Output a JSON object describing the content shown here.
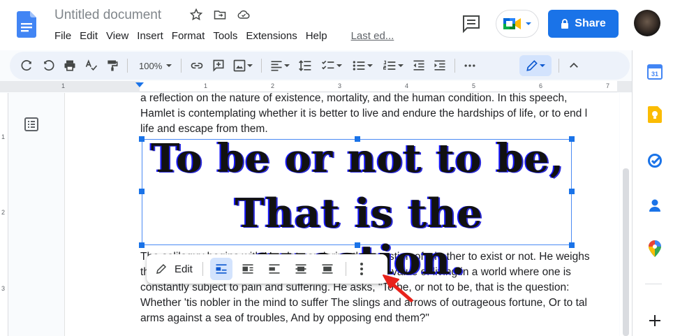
{
  "app": {
    "title": "Untitled document",
    "menu": [
      "File",
      "Edit",
      "View",
      "Insert",
      "Format",
      "Tools",
      "Extensions",
      "Help"
    ],
    "last_edit": "Last ed...",
    "share_label": "Share"
  },
  "toolbar": {
    "zoom": "100%"
  },
  "ruler": {
    "marks": [
      "1",
      "1",
      "2",
      "3",
      "4",
      "5",
      "6",
      "7"
    ],
    "vertical_marks": [
      "1",
      "2",
      "3"
    ]
  },
  "document": {
    "para1": [
      "a reflection on the nature of existence, mortality, and the human condition. In this speech,",
      "Hamlet is contemplating whether it is better to live and endure the hardships of life, or to end l",
      "life and escape from them."
    ],
    "quote": [
      "To be or not to be,",
      "That is the question."
    ],
    "para2": [
      "The soliloquy begins with Hamlet pondering the question of whether to exist or not. He weighs",
      "the pros and cons of both options and considers the value of living in a world where one is",
      "constantly subject to pain and suffering. He asks, \"To be, or not to be, that is the question:",
      "Whether 'tis nobler in the mind to suffer The slings and arrows of outrageous fortune, Or to tal",
      "arms against a sea of troubles, And by opposing end them?\""
    ]
  },
  "image_toolbar": {
    "edit_label": "Edit"
  },
  "colors": {
    "accent": "#1a73e8",
    "toolbar_bg": "#edf2fa",
    "arrow": "#e8221b"
  }
}
